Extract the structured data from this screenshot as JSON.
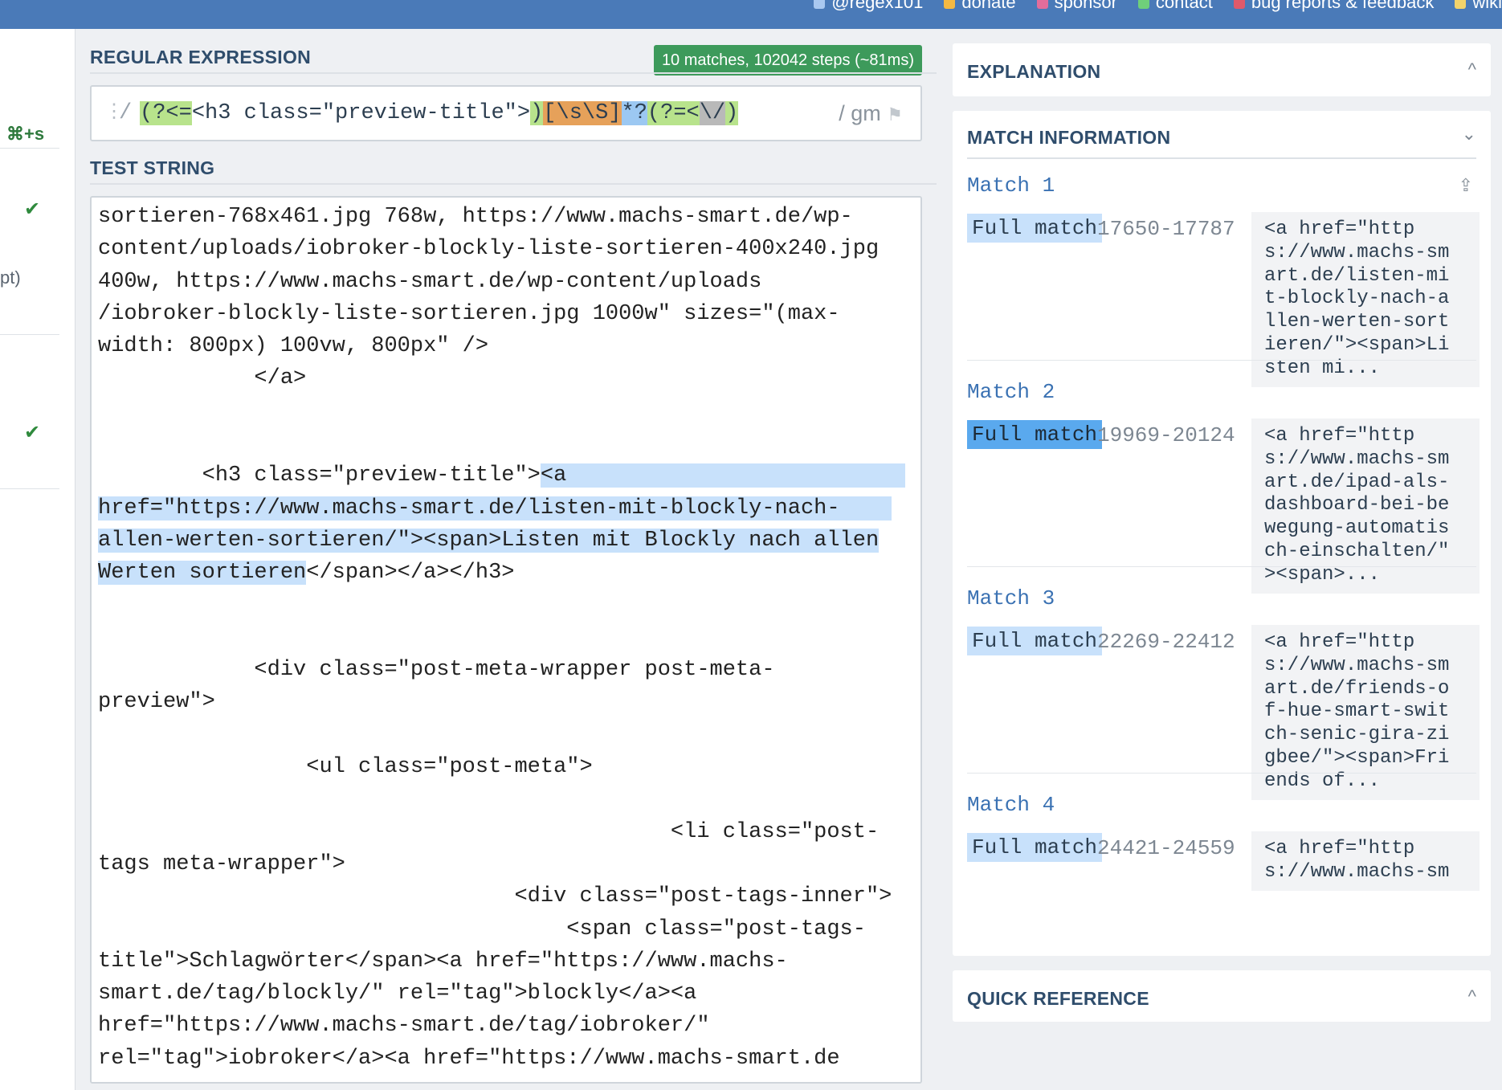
{
  "topbar": {
    "links": [
      {
        "label": "@regex101",
        "color": "#a9c8f0"
      },
      {
        "label": "donate",
        "color": "#f4b942"
      },
      {
        "label": "sponsor",
        "color": "#e36d9b"
      },
      {
        "label": "contact",
        "color": "#6fcf7a"
      },
      {
        "label": "bug reports & feedback",
        "color": "#e05a6b"
      },
      {
        "label": "wiki",
        "color": "#f2d36b"
      }
    ]
  },
  "sidebar": {
    "shortcut": "⌘+s",
    "fragment": "pt)",
    "check_icon": "✔"
  },
  "regex": {
    "title": "REGULAR EXPRESSION",
    "match_badge": "10 matches, 102042 steps (~81ms)",
    "delimiter_open": "/",
    "tokens": [
      {
        "text": "(?<=",
        "cls": "t-look"
      },
      {
        "text": "<h3 class=\"preview-title\">",
        "cls": "t-lit"
      },
      {
        "text": ")",
        "cls": "t-look"
      },
      {
        "text": "[\\s\\S]",
        "cls": "t-class"
      },
      {
        "text": "*?",
        "cls": "t-quant"
      },
      {
        "text": "(?=",
        "cls": "t-look"
      },
      {
        "text": "<",
        "cls": "t-look"
      },
      {
        "text": "\\/",
        "cls": "t-esc"
      },
      {
        "text": ")",
        "cls": "t-look"
      }
    ],
    "flags": "/ gm"
  },
  "test_string": {
    "title": "TEST STRING",
    "lines": [
      [
        {
          "t": "sortieren-768x461.jpg 768w, https://www.machs-smart.de/wp-"
        }
      ],
      [
        {
          "t": "content/uploads/iobroker-blockly-liste-sortieren-400x240.jpg"
        }
      ],
      [
        {
          "t": "400w, https://www.machs-smart.de/wp-content/uploads"
        }
      ],
      [
        {
          "t": "/iobroker-blockly-liste-sortieren.jpg 1000w\" sizes=\"(max-"
        }
      ],
      [
        {
          "t": "width: 800px) 100vw, 800px\" />"
        }
      ],
      [
        {
          "t": "            </a>"
        }
      ],
      [
        {
          "t": ""
        }
      ],
      [
        {
          "t": ""
        }
      ],
      [
        {
          "t": "        <h3 class=\"preview-title\">"
        },
        {
          "t": "<a                          ",
          "hl": true
        }
      ],
      [
        {
          "t": "href=\"https://www.machs-smart.de/listen-mit-blockly-nach-    ",
          "hl": true
        }
      ],
      [
        {
          "t": "allen-werten-sortieren/\"><span>Listen mit Blockly nach allen",
          "hl": true
        }
      ],
      [
        {
          "t": "Werten sortieren",
          "hl": true
        },
        {
          "t": "</span></a></h3>"
        }
      ],
      [
        {
          "t": ""
        }
      ],
      [
        {
          "t": ""
        }
      ],
      [
        {
          "t": "            <div class=\"post-meta-wrapper post-meta-"
        }
      ],
      [
        {
          "t": "preview\">"
        }
      ],
      [
        {
          "t": ""
        }
      ],
      [
        {
          "t": "                <ul class=\"post-meta\">"
        }
      ],
      [
        {
          "t": ""
        }
      ],
      [
        {
          "t": "                                            <li class=\"post-"
        }
      ],
      [
        {
          "t": "tags meta-wrapper\">"
        }
      ],
      [
        {
          "t": "                                <div class=\"post-tags-inner\">"
        }
      ],
      [
        {
          "t": "                                    <span class=\"post-tags-"
        }
      ],
      [
        {
          "t": "title\">Schlagwörter</span><a href=\"https://www.machs-"
        }
      ],
      [
        {
          "t": "smart.de/tag/blockly/\" rel=\"tag\">blockly</a><a"
        }
      ],
      [
        {
          "t": "href=\"https://www.machs-smart.de/tag/iobroker/\""
        }
      ],
      [
        {
          "t": "rel=\"tag\">iobroker</a><a href=\"https://www.machs-smart.de"
        }
      ]
    ]
  },
  "explanation": {
    "title": "EXPLANATION",
    "chevron": "^"
  },
  "match_info": {
    "title": "MATCH INFORMATION",
    "chevron": "⌄",
    "matches": [
      {
        "title": "Match 1",
        "label": "Full match",
        "range": "17650-17787",
        "value": "<a href=\"http\ns://www.machs-sm\nart.de/listen-mi\nt-blockly-nach-a\nllen-werten-sort\nieren/\"><span>Li\nsten mi...",
        "active": false
      },
      {
        "title": "Match 2",
        "label": "Full match",
        "range": "19969-20124",
        "value": "<a href=\"http\ns://www.machs-sm\nart.de/ipad-als-\ndashboard-bei-be\nwegung-automatis\nch-einschalten/\"\n><span>...",
        "active": true
      },
      {
        "title": "Match 3",
        "label": "Full match",
        "range": "22269-22412",
        "value": "<a href=\"http\ns://www.machs-sm\nart.de/friends-o\nf-hue-smart-swit\nch-senic-gira-zi\ngbee/\"><span>Fri\nends of...",
        "active": false
      },
      {
        "title": "Match 4",
        "label": "Full match",
        "range": "24421-24559",
        "value": "<a href=\"http\ns://www.machs-sm",
        "active": false
      }
    ]
  },
  "quick_reference": {
    "title": "QUICK REFERENCE",
    "chevron": "^"
  }
}
